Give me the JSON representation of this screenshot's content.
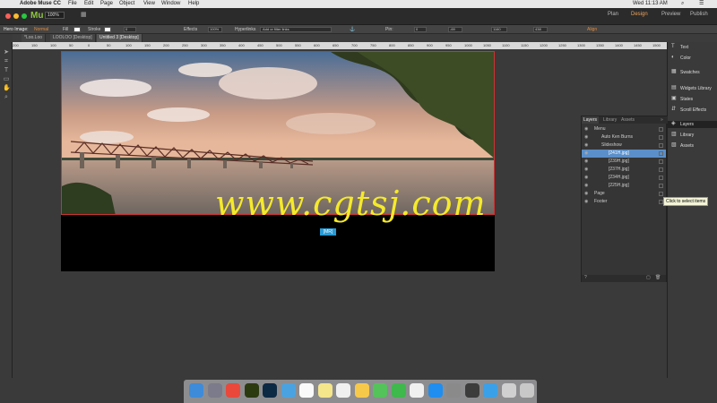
{
  "menubar": {
    "app": "Adobe Muse CC",
    "items": [
      "File",
      "Edit",
      "Page",
      "Object",
      "View",
      "Window",
      "Help"
    ],
    "clock": "Wed 11:13 AM"
  },
  "appbar": {
    "logo": "Mu",
    "zoom": "100%",
    "modes": [
      "Plan",
      "Design",
      "Preview",
      "Publish"
    ],
    "active_mode": "Design"
  },
  "options": {
    "selection": "Hero Image:",
    "state": "Normal",
    "fill": "Fill",
    "stroke": "Stroke",
    "stroke_val": "0",
    "effects": "Effects",
    "opacity": "100%",
    "hyperlinks": "Hyperlinks",
    "link_placeholder": "Add or filter links",
    "pin": "Pin:",
    "x": "0",
    "y": "-69",
    "w": "1160",
    "h": "438",
    "align": "Align"
  },
  "tabs": [
    {
      "label": "*Loo.Loo"
    },
    {
      "label": "LOOLOO [Desktop]"
    },
    {
      "label": "Untitled 3 [Desktop]"
    }
  ],
  "ruler": [
    "200",
    "150",
    "100",
    "50",
    "0",
    "50",
    "100",
    "150",
    "200",
    "250",
    "300",
    "350",
    "400",
    "450",
    "500",
    "550",
    "600",
    "650",
    "700",
    "750",
    "800",
    "850",
    "900",
    "950",
    "1000",
    "1050",
    "1100",
    "1150",
    "1200",
    "1250",
    "1300",
    "1350",
    "1400",
    "1450",
    "1500",
    "1550"
  ],
  "canvas": {
    "watermark": "www.cgtsj.com",
    "tag": "[MR]"
  },
  "right_panel": {
    "items": [
      "Text",
      "Color",
      "Swatches",
      "Widgets Library",
      "States",
      "Scroll Effects",
      "Layers",
      "Library",
      "Assets"
    ],
    "selected": "Layers"
  },
  "layers": {
    "tabs": [
      "Layers",
      "Library",
      "Assets"
    ],
    "rows": [
      {
        "label": "Menu",
        "indent": 0
      },
      {
        "label": "Auto Ken Burns",
        "indent": 1
      },
      {
        "label": "Slideshow",
        "indent": 1
      },
      {
        "label": "[241H.jpg]",
        "indent": 2
      },
      {
        "label": "[239H.jpg]",
        "indent": 2
      },
      {
        "label": "[237H.jpg]",
        "indent": 2
      },
      {
        "label": "[234H.jpg]",
        "indent": 2
      },
      {
        "label": "[225H.jpg]",
        "indent": 2
      },
      {
        "label": "Page",
        "indent": 0
      },
      {
        "label": "Footer",
        "indent": 0
      }
    ],
    "selected_index": 3,
    "tooltip": "Click to select items"
  },
  "dock": {
    "icons": [
      "finder-icon",
      "launchpad-icon",
      "chrome-icon",
      "muse-icon",
      "photoshop-icon",
      "downloads-icon",
      "calendar-icon",
      "notes-icon",
      "reminders-icon",
      "photos-icon",
      "messages-icon",
      "facetime-icon",
      "itunes-icon",
      "appstore-icon",
      "system-preferences-icon",
      "quicktime-icon",
      "safari-icon",
      "preview-icon",
      "trash-icon"
    ]
  }
}
